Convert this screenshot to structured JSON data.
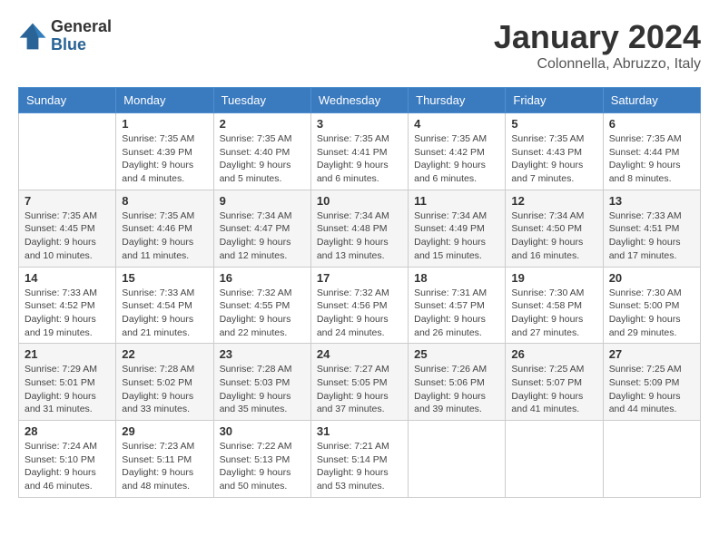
{
  "logo": {
    "general": "General",
    "blue": "Blue"
  },
  "header": {
    "month": "January 2024",
    "location": "Colonnella, Abruzzo, Italy"
  },
  "weekdays": [
    "Sunday",
    "Monday",
    "Tuesday",
    "Wednesday",
    "Thursday",
    "Friday",
    "Saturday"
  ],
  "weeks": [
    [
      {
        "day": "",
        "sunrise": "",
        "sunset": "",
        "daylight": ""
      },
      {
        "day": "1",
        "sunrise": "Sunrise: 7:35 AM",
        "sunset": "Sunset: 4:39 PM",
        "daylight": "Daylight: 9 hours and 4 minutes."
      },
      {
        "day": "2",
        "sunrise": "Sunrise: 7:35 AM",
        "sunset": "Sunset: 4:40 PM",
        "daylight": "Daylight: 9 hours and 5 minutes."
      },
      {
        "day": "3",
        "sunrise": "Sunrise: 7:35 AM",
        "sunset": "Sunset: 4:41 PM",
        "daylight": "Daylight: 9 hours and 6 minutes."
      },
      {
        "day": "4",
        "sunrise": "Sunrise: 7:35 AM",
        "sunset": "Sunset: 4:42 PM",
        "daylight": "Daylight: 9 hours and 6 minutes."
      },
      {
        "day": "5",
        "sunrise": "Sunrise: 7:35 AM",
        "sunset": "Sunset: 4:43 PM",
        "daylight": "Daylight: 9 hours and 7 minutes."
      },
      {
        "day": "6",
        "sunrise": "Sunrise: 7:35 AM",
        "sunset": "Sunset: 4:44 PM",
        "daylight": "Daylight: 9 hours and 8 minutes."
      }
    ],
    [
      {
        "day": "7",
        "sunrise": "Sunrise: 7:35 AM",
        "sunset": "Sunset: 4:45 PM",
        "daylight": "Daylight: 9 hours and 10 minutes."
      },
      {
        "day": "8",
        "sunrise": "Sunrise: 7:35 AM",
        "sunset": "Sunset: 4:46 PM",
        "daylight": "Daylight: 9 hours and 11 minutes."
      },
      {
        "day": "9",
        "sunrise": "Sunrise: 7:34 AM",
        "sunset": "Sunset: 4:47 PM",
        "daylight": "Daylight: 9 hours and 12 minutes."
      },
      {
        "day": "10",
        "sunrise": "Sunrise: 7:34 AM",
        "sunset": "Sunset: 4:48 PM",
        "daylight": "Daylight: 9 hours and 13 minutes."
      },
      {
        "day": "11",
        "sunrise": "Sunrise: 7:34 AM",
        "sunset": "Sunset: 4:49 PM",
        "daylight": "Daylight: 9 hours and 15 minutes."
      },
      {
        "day": "12",
        "sunrise": "Sunrise: 7:34 AM",
        "sunset": "Sunset: 4:50 PM",
        "daylight": "Daylight: 9 hours and 16 minutes."
      },
      {
        "day": "13",
        "sunrise": "Sunrise: 7:33 AM",
        "sunset": "Sunset: 4:51 PM",
        "daylight": "Daylight: 9 hours and 17 minutes."
      }
    ],
    [
      {
        "day": "14",
        "sunrise": "Sunrise: 7:33 AM",
        "sunset": "Sunset: 4:52 PM",
        "daylight": "Daylight: 9 hours and 19 minutes."
      },
      {
        "day": "15",
        "sunrise": "Sunrise: 7:33 AM",
        "sunset": "Sunset: 4:54 PM",
        "daylight": "Daylight: 9 hours and 21 minutes."
      },
      {
        "day": "16",
        "sunrise": "Sunrise: 7:32 AM",
        "sunset": "Sunset: 4:55 PM",
        "daylight": "Daylight: 9 hours and 22 minutes."
      },
      {
        "day": "17",
        "sunrise": "Sunrise: 7:32 AM",
        "sunset": "Sunset: 4:56 PM",
        "daylight": "Daylight: 9 hours and 24 minutes."
      },
      {
        "day": "18",
        "sunrise": "Sunrise: 7:31 AM",
        "sunset": "Sunset: 4:57 PM",
        "daylight": "Daylight: 9 hours and 26 minutes."
      },
      {
        "day": "19",
        "sunrise": "Sunrise: 7:30 AM",
        "sunset": "Sunset: 4:58 PM",
        "daylight": "Daylight: 9 hours and 27 minutes."
      },
      {
        "day": "20",
        "sunrise": "Sunrise: 7:30 AM",
        "sunset": "Sunset: 5:00 PM",
        "daylight": "Daylight: 9 hours and 29 minutes."
      }
    ],
    [
      {
        "day": "21",
        "sunrise": "Sunrise: 7:29 AM",
        "sunset": "Sunset: 5:01 PM",
        "daylight": "Daylight: 9 hours and 31 minutes."
      },
      {
        "day": "22",
        "sunrise": "Sunrise: 7:28 AM",
        "sunset": "Sunset: 5:02 PM",
        "daylight": "Daylight: 9 hours and 33 minutes."
      },
      {
        "day": "23",
        "sunrise": "Sunrise: 7:28 AM",
        "sunset": "Sunset: 5:03 PM",
        "daylight": "Daylight: 9 hours and 35 minutes."
      },
      {
        "day": "24",
        "sunrise": "Sunrise: 7:27 AM",
        "sunset": "Sunset: 5:05 PM",
        "daylight": "Daylight: 9 hours and 37 minutes."
      },
      {
        "day": "25",
        "sunrise": "Sunrise: 7:26 AM",
        "sunset": "Sunset: 5:06 PM",
        "daylight": "Daylight: 9 hours and 39 minutes."
      },
      {
        "day": "26",
        "sunrise": "Sunrise: 7:25 AM",
        "sunset": "Sunset: 5:07 PM",
        "daylight": "Daylight: 9 hours and 41 minutes."
      },
      {
        "day": "27",
        "sunrise": "Sunrise: 7:25 AM",
        "sunset": "Sunset: 5:09 PM",
        "daylight": "Daylight: 9 hours and 44 minutes."
      }
    ],
    [
      {
        "day": "28",
        "sunrise": "Sunrise: 7:24 AM",
        "sunset": "Sunset: 5:10 PM",
        "daylight": "Daylight: 9 hours and 46 minutes."
      },
      {
        "day": "29",
        "sunrise": "Sunrise: 7:23 AM",
        "sunset": "Sunset: 5:11 PM",
        "daylight": "Daylight: 9 hours and 48 minutes."
      },
      {
        "day": "30",
        "sunrise": "Sunrise: 7:22 AM",
        "sunset": "Sunset: 5:13 PM",
        "daylight": "Daylight: 9 hours and 50 minutes."
      },
      {
        "day": "31",
        "sunrise": "Sunrise: 7:21 AM",
        "sunset": "Sunset: 5:14 PM",
        "daylight": "Daylight: 9 hours and 53 minutes."
      },
      {
        "day": "",
        "sunrise": "",
        "sunset": "",
        "daylight": ""
      },
      {
        "day": "",
        "sunrise": "",
        "sunset": "",
        "daylight": ""
      },
      {
        "day": "",
        "sunrise": "",
        "sunset": "",
        "daylight": ""
      }
    ]
  ]
}
